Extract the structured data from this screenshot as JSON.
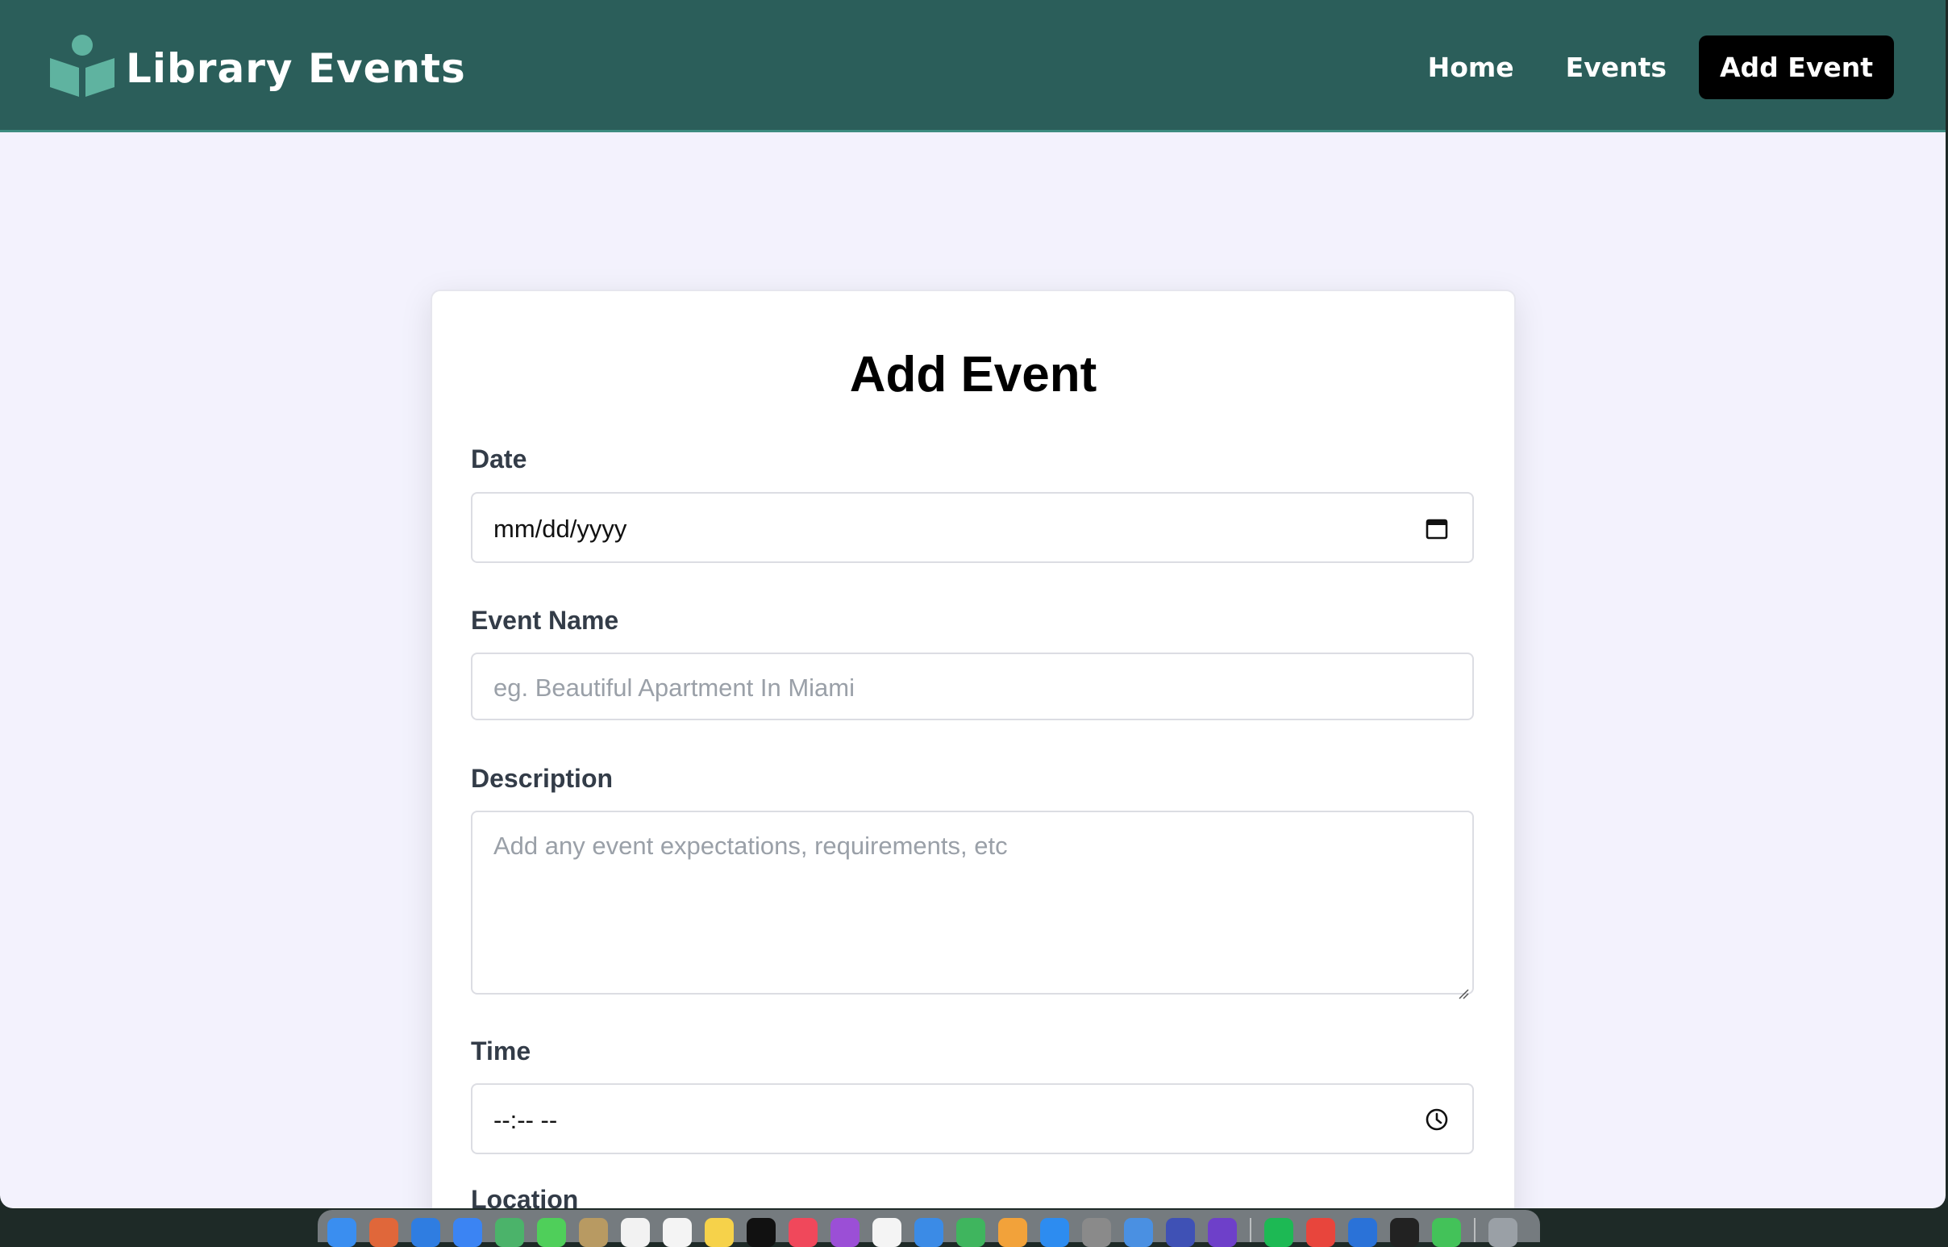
{
  "navbar": {
    "brand": "Library Events",
    "links": [
      {
        "label": "Home"
      },
      {
        "label": "Events"
      },
      {
        "label": "Add Event"
      }
    ]
  },
  "form": {
    "title": "Add Event",
    "date": {
      "label": "Date",
      "value": "mm/dd/yyyy"
    },
    "event_name": {
      "label": "Event Name",
      "placeholder": "eg. Beautiful Apartment In Miami"
    },
    "description": {
      "label": "Description",
      "placeholder": "Add any event expectations, requirements, etc"
    },
    "time": {
      "label": "Time",
      "value": "--:-- --"
    },
    "location": {
      "label": "Location"
    }
  },
  "colors": {
    "navbar": "#2b5e5a",
    "active_link": "#000000",
    "page_background": "#f3f2fd",
    "brand_icon": "#5fb3a0"
  },
  "icons": {
    "brand": "book-reader-icon",
    "date": "calendar-icon",
    "time": "clock-icon"
  }
}
